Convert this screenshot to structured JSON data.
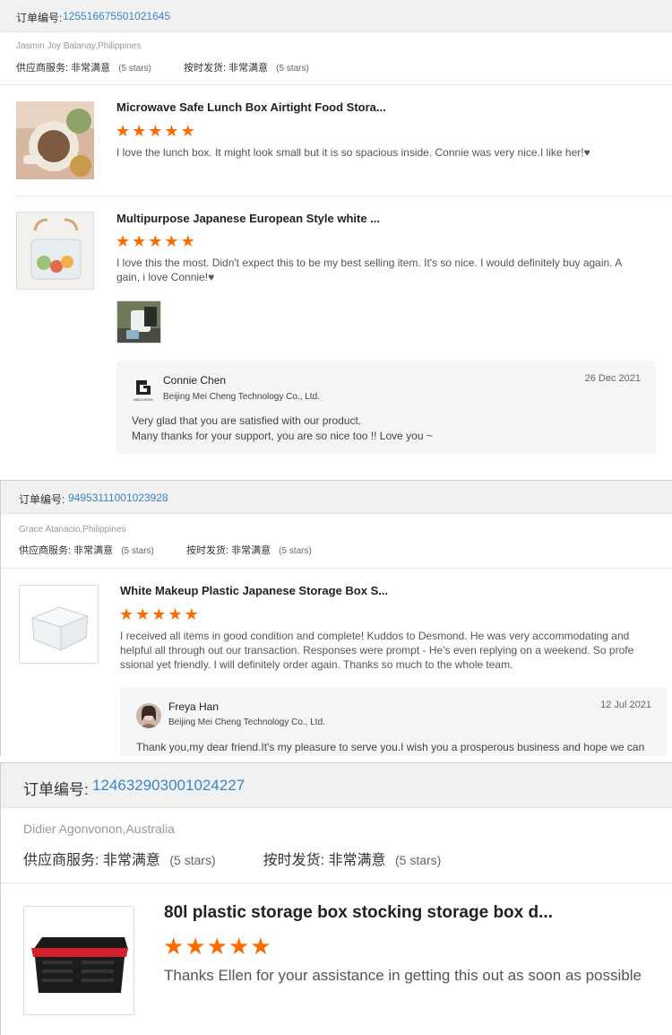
{
  "orders": [
    {
      "order_label": "订单编号:",
      "order_number": "125516675501021645",
      "buyer": "Jasmin Joy Balanay,Philippines",
      "supplier_service_label": "供应商服务:",
      "supplier_service_value": "非常满意",
      "supplier_service_stars": "(5 stars)",
      "shipping_label": "按时发货:",
      "shipping_value": "非常满意",
      "shipping_stars": "(5 stars)",
      "products": [
        {
          "title": "Microwave Safe Lunch Box Airtight Food Stora...",
          "rating": 5,
          "review": "I love the lunch box. It might look small but it is so spacious inside. Connie was very nice.I like her!♥"
        },
        {
          "title": "Multipurpose Japanese European Style white ...",
          "rating": 5,
          "review": "I love this the most. Didn't expect this to be my best selling item. It's so nice. I would definitely buy again. A gain, i love Connie!♥",
          "reply": {
            "name": "Connie Chen",
            "company": "Beijing Mei Cheng Technology Co., Ltd.",
            "date": "26 Dec 2021",
            "logo_text": "MEICHENG",
            "text_line1": "Very glad that you are satisfied with our product.",
            "text_line2": "Many thanks for your support, you are so nice too !! Love you ~"
          }
        }
      ]
    },
    {
      "order_label": "订单编号:",
      "order_number": "94953111001023928",
      "buyer": "Grace Atanacio,Philippines",
      "supplier_service_label": "供应商服务:",
      "supplier_service_value": "非常满意",
      "supplier_service_stars": "(5 stars)",
      "shipping_label": "按时发货:",
      "shipping_value": "非常满意",
      "shipping_stars": "(5 stars)",
      "products": [
        {
          "title": "White Makeup Plastic Japanese Storage Box S...",
          "rating": 5,
          "review": "I received all items in good condition and complete! Kuddos to Desmond. He was very accommodating and helpful all through out our transaction. Responses were prompt - He's even replying on a weekend. So profe ssional yet friendly. I will definitely order again. Thanks so much to the whole team.",
          "reply": {
            "name": "Freya Han",
            "company": "Beijing Mei Cheng Technology Co., Ltd.",
            "date": "12 Jul 2021",
            "text_line1": "Thank you,my dear friend.It's my pleasure to serve you.I wish you a prosperous business and hope we can"
          }
        }
      ]
    },
    {
      "order_label": "订单编号:",
      "order_number": "124632903001024227",
      "buyer": "Didier Agonvonon,Australia",
      "supplier_service_label": "供应商服务:",
      "supplier_service_value": "非常满意",
      "supplier_service_stars": "(5 stars)",
      "shipping_label": "按时发货:",
      "shipping_value": "非常满意",
      "shipping_stars": "(5 stars)",
      "products": [
        {
          "title": "80l plastic storage box stocking storage box d...",
          "rating": 5,
          "review": "Thanks Ellen for your assistance in getting this out as soon as possible"
        }
      ]
    }
  ],
  "colors": {
    "accent_link": "#3a86c8",
    "star": "#ff6a00",
    "header_bg": "#f1f1f1",
    "reply_bg": "#f4f5f7"
  },
  "icons": {
    "star": "star-icon",
    "company_logo": "meicheng-logo-icon",
    "avatar": "avatar-icon"
  }
}
